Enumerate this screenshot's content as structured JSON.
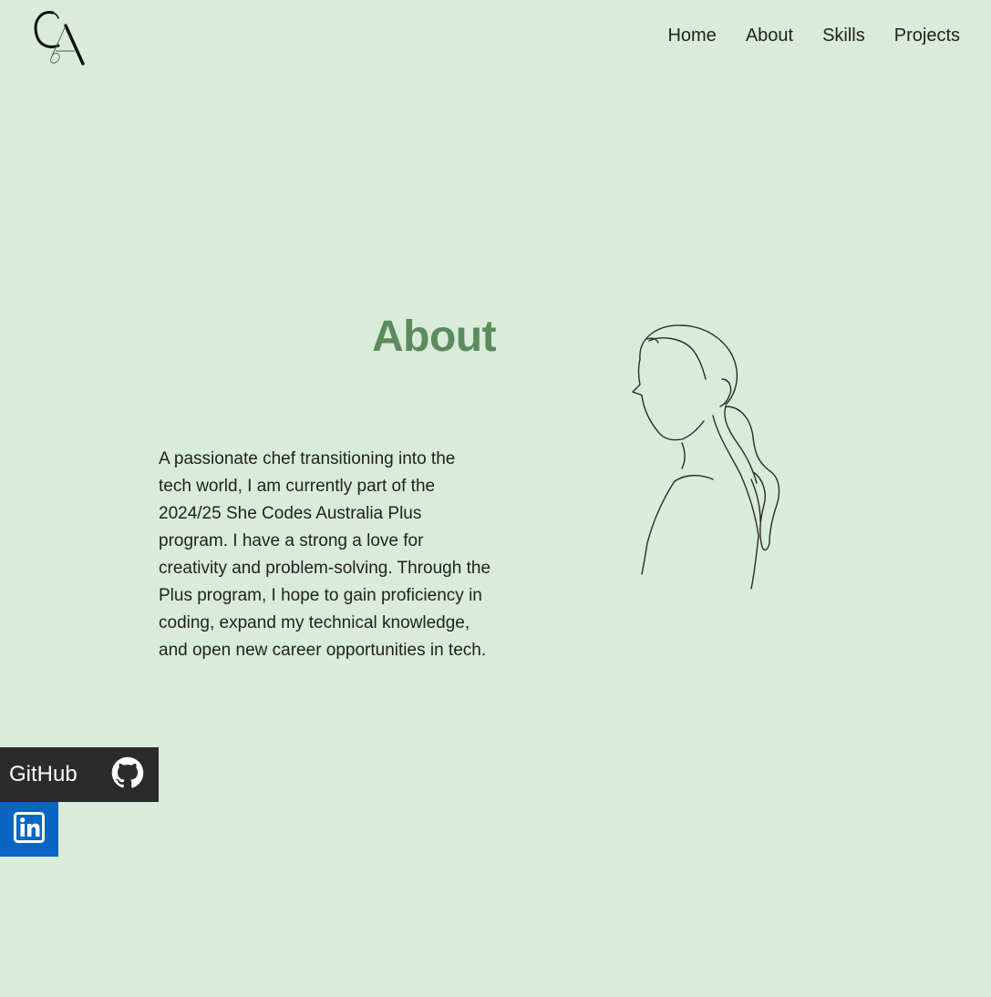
{
  "logo": {
    "alt": "CA monogram"
  },
  "nav": {
    "items": [
      {
        "label": "Home"
      },
      {
        "label": "About"
      },
      {
        "label": "Skills"
      },
      {
        "label": "Projects"
      }
    ]
  },
  "about": {
    "title": "About",
    "body": "A passionate chef transitioning into the tech world, I am currently part of the 2024/25 She Codes Australia Plus program. I have a strong a love for creativity and problem-solving. Through the Plus program, I hope to gain proficiency in coding, expand my technical knowledge, and open new career opportunities in tech."
  },
  "social": {
    "github": {
      "label": "GitHub",
      "icon": "github-icon"
    },
    "linkedin": {
      "icon": "linkedin-icon"
    }
  },
  "colors": {
    "background": "#d9ebd9",
    "accent": "#5b8a5f",
    "github_bg": "#2b2b2b",
    "linkedin_bg": "#0a66c2"
  }
}
